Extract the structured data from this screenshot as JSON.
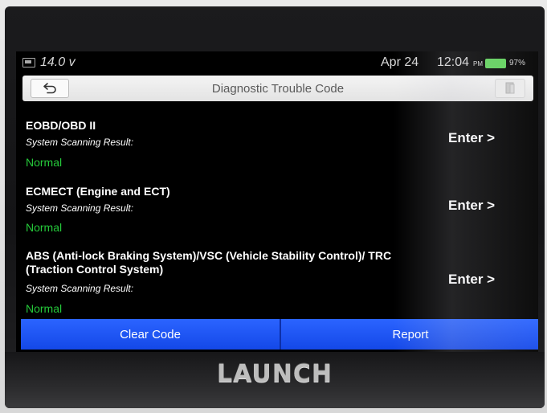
{
  "statusbar": {
    "voltage": "14.0 v",
    "date": "Apr 24",
    "time": "12:04",
    "ampm": "PM",
    "battery": "97%",
    "battery_color": "#5fd35a"
  },
  "header": {
    "title": "Diagnostic Trouble Code",
    "back_icon": "back-arrow-icon",
    "exit_icon": "exit-door-icon"
  },
  "results": [
    {
      "system": "EOBD/OBD II",
      "scan_label": "System Scanning Result:",
      "status": "Normal",
      "enter": "Enter >"
    },
    {
      "system": "ECMECT (Engine and ECT)",
      "scan_label": "System Scanning Result:",
      "status": "Normal",
      "enter": "Enter >"
    },
    {
      "system": "ABS (Anti-lock Braking System)/VSC (Vehicle Stability Control)/ TRC (Traction Control System)",
      "scan_label": "System Scanning Result:",
      "status": "Normal",
      "enter": "Enter >"
    }
  ],
  "actions": {
    "clear_code": "Clear Code",
    "report": "Report"
  },
  "device": {
    "brand": "LAUNCH"
  },
  "colors": {
    "accent_blue": "#1f56f5",
    "normal_green": "#25c93a"
  }
}
